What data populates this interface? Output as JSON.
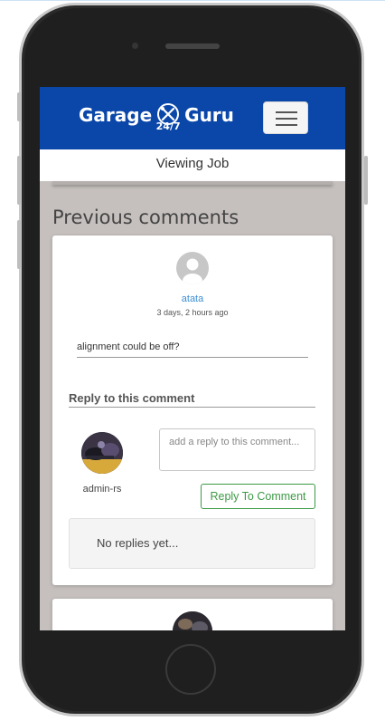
{
  "header": {
    "logo_word_left": "Garage",
    "logo_word_right": "Guru",
    "logo_badge_text": "24/7",
    "subheader_title": "Viewing Job"
  },
  "comments_section": {
    "title": "Previous comments",
    "comment": {
      "username": "atata",
      "time_ago": "3 days, 2 hours ago",
      "text": "alignment could be off?"
    },
    "reply_form": {
      "heading": "Reply to this comment",
      "current_user": "admin-rs",
      "placeholder": "add a reply to this comment...",
      "button_label": "Reply To Comment"
    },
    "replies_empty_text": "No replies yet..."
  },
  "colors": {
    "navbar": "#0a47a9",
    "link": "#3b8fd4",
    "button_green": "#3c9a45",
    "page_background": "#c5c0bd"
  },
  "icons": [
    "wrench-screwdriver-icon",
    "hamburger-menu-icon",
    "default-user-avatar-icon"
  ]
}
